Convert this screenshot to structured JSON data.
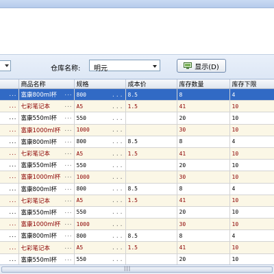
{
  "toolbar": {
    "store_label": "仓库名称:",
    "store_value": "明元",
    "show_button_label": "显示(D)"
  },
  "table": {
    "columns": [
      "",
      "商品名称",
      "规格",
      "成本价",
      "库存数量",
      "库存下限"
    ],
    "rows": [
      {
        "name": "富康800ml杯",
        "spec": "800",
        "cost": "8.5",
        "qty": "8",
        "min": "4"
      },
      {
        "name": "七彩笔记本",
        "spec": "A5",
        "cost": "1.5",
        "qty": "41",
        "min": "10"
      },
      {
        "name": "富康550ml杯",
        "spec": "550",
        "cost": "",
        "qty": "20",
        "min": "10"
      },
      {
        "name": "富康1000ml杯",
        "spec": "1000",
        "cost": "",
        "qty": "30",
        "min": "10"
      },
      {
        "name": "富康800ml杯",
        "spec": "800",
        "cost": "8.5",
        "qty": "8",
        "min": "4"
      },
      {
        "name": "七彩笔记本",
        "spec": "A5",
        "cost": "1.5",
        "qty": "41",
        "min": "10"
      },
      {
        "name": "富康550ml杯",
        "spec": "550",
        "cost": "",
        "qty": "20",
        "min": "10"
      },
      {
        "name": "富康1000ml杯",
        "spec": "1000",
        "cost": "",
        "qty": "30",
        "min": "10"
      },
      {
        "name": "富康800ml杯",
        "spec": "800",
        "cost": "8.5",
        "qty": "8",
        "min": "4"
      },
      {
        "name": "七彩笔记本",
        "spec": "A5",
        "cost": "1.5",
        "qty": "41",
        "min": "10"
      },
      {
        "name": "富康550ml杯",
        "spec": "550",
        "cost": "",
        "qty": "20",
        "min": "10"
      },
      {
        "name": "富康1000ml杯",
        "spec": "1000",
        "cost": "",
        "qty": "30",
        "min": "10"
      },
      {
        "name": "富康800ml杯",
        "spec": "800",
        "cost": "8.5",
        "qty": "8",
        "min": "4"
      },
      {
        "name": "七彩笔记本",
        "spec": "A5",
        "cost": "1.5",
        "qty": "41",
        "min": "10"
      },
      {
        "name": "富康550ml杯",
        "spec": "550",
        "cost": "",
        "qty": "20",
        "min": "10"
      }
    ],
    "selected_row": 0
  },
  "scrollbar": {
    "grip": "|||"
  },
  "colors": {
    "selected_bg": "#316ac5",
    "alt_row_bg": "#fbf7e6",
    "alt_row_text": "#8b0000"
  },
  "icons": {
    "show_button": "display-icon"
  }
}
